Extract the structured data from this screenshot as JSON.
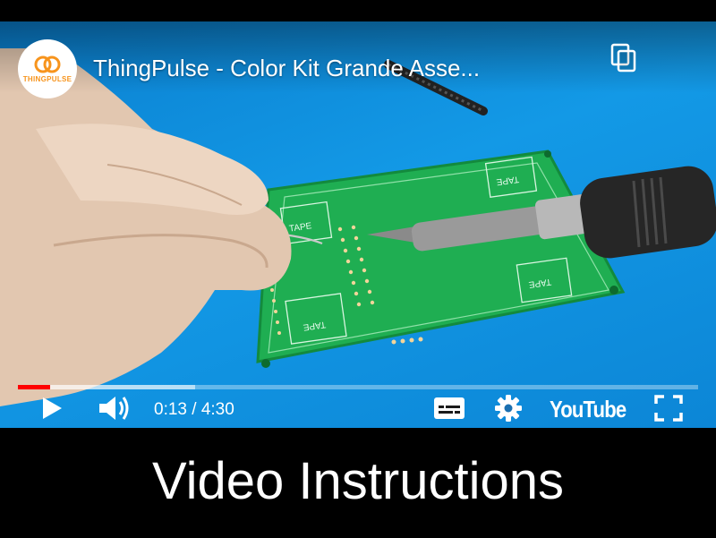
{
  "video": {
    "channel_logo_text": "THINGPULSE",
    "title": "ThingPulse - Color Kit Grande Asse...",
    "pcb_label": "TAPE",
    "progress_played_fraction": 0.047,
    "progress_buffered_fraction": 0.26,
    "current_time": "0:13",
    "time_separator": " / ",
    "duration": "4:30",
    "time_display": "0:13 / 4:30",
    "youtube_label": "YouTube"
  },
  "caption": {
    "text": "Video Instructions"
  },
  "colors": {
    "background": "#000000",
    "sky": "#1399e6",
    "pcb": "#1fae52",
    "progress": "#ff0000",
    "logo_accent": "#f7941d"
  },
  "icons": [
    "copy-link-icon",
    "play-icon",
    "volume-icon",
    "subtitles-icon",
    "settings-gear-icon",
    "fullscreen-icon"
  ]
}
